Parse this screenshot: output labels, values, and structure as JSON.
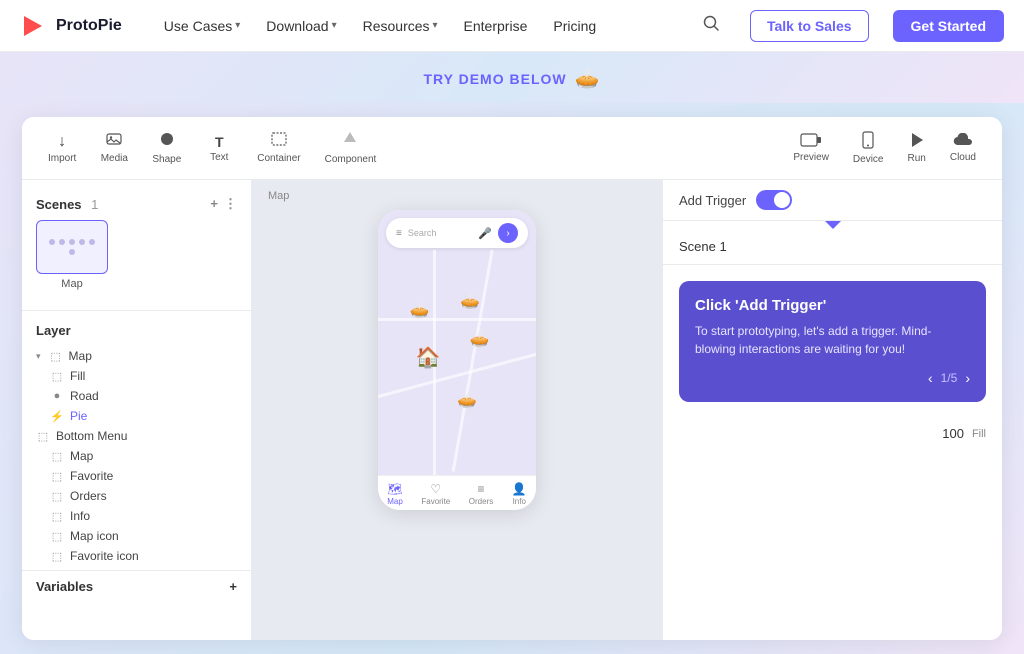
{
  "nav": {
    "logo_text": "ProtoPie",
    "items": [
      {
        "label": "Use Cases",
        "has_dropdown": true
      },
      {
        "label": "Download",
        "has_dropdown": true
      },
      {
        "label": "Resources",
        "has_dropdown": true
      },
      {
        "label": "Enterprise",
        "has_dropdown": false
      },
      {
        "label": "Pricing",
        "has_dropdown": false
      }
    ],
    "talk_to_sales": "Talk to Sales",
    "get_started": "Get Started"
  },
  "hero": {
    "text": "TRY DEMO BELOW",
    "emoji": "🥧"
  },
  "toolbar": {
    "tools": [
      {
        "label": "Import",
        "icon": "↓"
      },
      {
        "label": "Media",
        "icon": "🖼"
      },
      {
        "label": "Shape",
        "icon": "⬤"
      },
      {
        "label": "Text",
        "icon": "T"
      },
      {
        "label": "Container",
        "icon": "⬚"
      },
      {
        "label": "Component",
        "icon": "⚡"
      }
    ],
    "right_tools": [
      {
        "label": "Preview",
        "icon": "▬"
      },
      {
        "label": "Device",
        "icon": "📱"
      },
      {
        "label": "Run",
        "icon": "▶"
      },
      {
        "label": "Cloud",
        "icon": "☁"
      }
    ]
  },
  "sidebar": {
    "scenes_label": "Scenes",
    "scenes_count": "1",
    "scene_name": "Map",
    "layer_label": "Layer",
    "layers": [
      {
        "name": "Map",
        "icon": "⬚",
        "indent": 0,
        "has_toggle": true
      },
      {
        "name": "Fill",
        "icon": "⬚",
        "indent": 1
      },
      {
        "name": "Road",
        "icon": "●",
        "indent": 1
      },
      {
        "name": "Pie",
        "icon": "⚡",
        "indent": 1,
        "active": true
      },
      {
        "name": "Bottom Menu",
        "icon": "⬚",
        "indent": 0
      },
      {
        "name": "Map",
        "icon": "⬚",
        "indent": 1
      },
      {
        "name": "Favorite",
        "icon": "⬚",
        "indent": 1
      },
      {
        "name": "Orders",
        "icon": "⬚",
        "indent": 1
      },
      {
        "name": "Info",
        "icon": "⬚",
        "indent": 1
      },
      {
        "name": "Map icon",
        "icon": "⬚",
        "indent": 1
      },
      {
        "name": "Favorite icon",
        "icon": "⬚",
        "indent": 1
      }
    ],
    "variables_label": "Variables"
  },
  "canvas": {
    "label": "Map"
  },
  "phone": {
    "search_placeholder": "Search",
    "nav_items": [
      {
        "label": "Map",
        "icon": "🗺",
        "active": true
      },
      {
        "label": "Favorite",
        "icon": "♡"
      },
      {
        "label": "Orders",
        "icon": "≡"
      },
      {
        "label": "Info",
        "icon": "👤"
      }
    ]
  },
  "right_panel": {
    "trigger_label": "Add Trigger",
    "scene_label": "Scene 1",
    "tooltip": {
      "title": "Click 'Add Trigger'",
      "body": "To start prototyping, let's add a trigger. Mind-blowing interactions are waiting for you!",
      "page_current": "1",
      "page_total": "5"
    },
    "fill_value": "100",
    "fill_label": "Fill"
  }
}
